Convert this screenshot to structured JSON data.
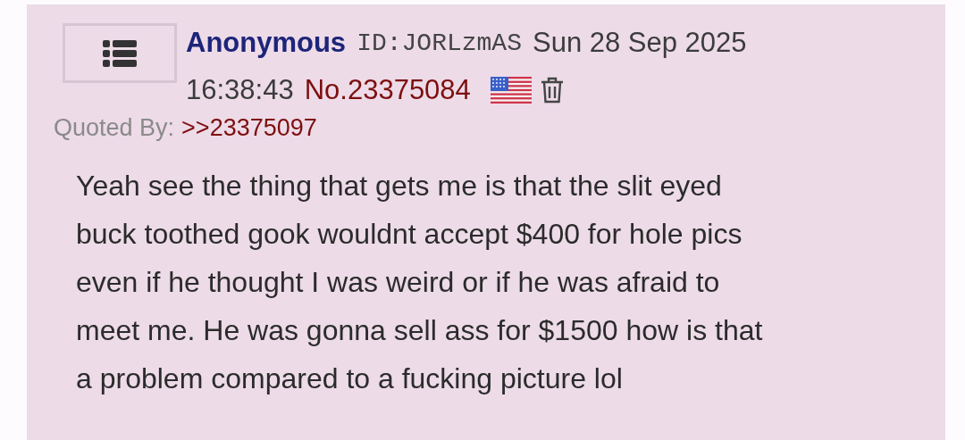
{
  "post": {
    "name": "Anonymous",
    "id_label": "ID:",
    "id": "JORLzmAS",
    "date": "Sun 28 Sep 2025",
    "time": "16:38:43",
    "number": "No.23375084",
    "quoted_by_label": "Quoted By:",
    "quoted_by": [
      ">>23375097"
    ],
    "body": [
      "Yeah see the thing that gets me is that the slit eyed",
      "buck toothed gook wouldnt accept $400 for hole pics",
      "even if he thought I was weird or if he was afraid to",
      "meet me. He was gonna sell ass for $1500 how is that",
      "a problem compared to a fucking picture lol"
    ]
  }
}
